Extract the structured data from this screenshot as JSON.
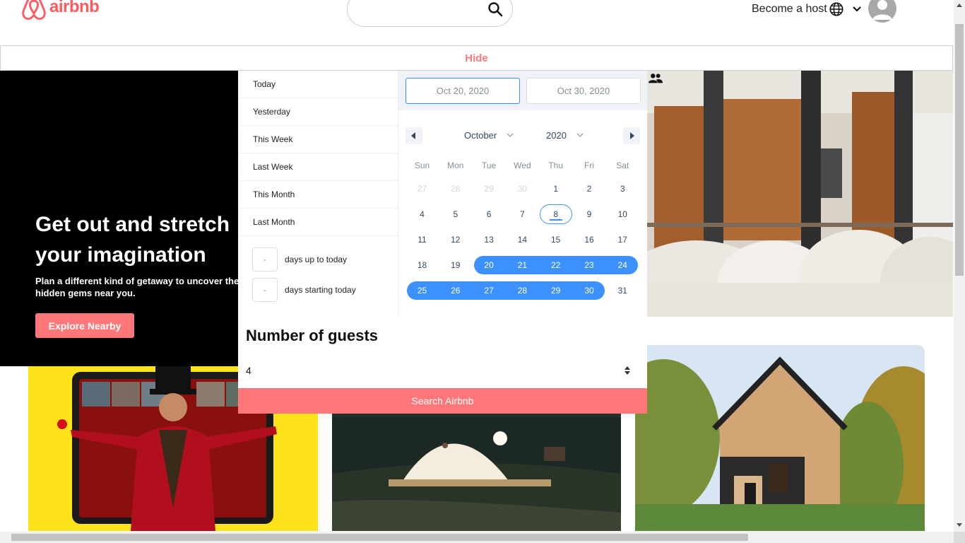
{
  "header": {
    "logo_text": "airbnb",
    "become_host": "Become a host"
  },
  "hide_label": "Hide",
  "hero": {
    "title_line1": "Get out and stretch",
    "title_line2": "your imagination",
    "subtitle_line1": "Plan a different kind of getaway to uncover the",
    "subtitle_line2": "hidden gems near you.",
    "explore_label": "Explore Nearby"
  },
  "date_picker": {
    "static_ranges": [
      "Today",
      "Yesterday",
      "This Week",
      "Last Week",
      "This Month",
      "Last Month"
    ],
    "input_ranges": [
      {
        "value": "-",
        "label": "days up to today"
      },
      {
        "value": "-",
        "label": "days starting today"
      }
    ],
    "start_date": "Oct 20, 2020",
    "end_date": "Oct 30, 2020",
    "month": "October",
    "year": "2020",
    "weekdays": [
      "Sun",
      "Mon",
      "Tue",
      "Wed",
      "Thu",
      "Fri",
      "Sat"
    ],
    "weeks": [
      [
        "27",
        "28",
        "29",
        "30",
        "1",
        "2",
        "3"
      ],
      [
        "4",
        "5",
        "6",
        "7",
        "8",
        "9",
        "10"
      ],
      [
        "11",
        "12",
        "13",
        "14",
        "15",
        "16",
        "17"
      ],
      [
        "18",
        "19",
        "20",
        "21",
        "22",
        "23",
        "24"
      ],
      [
        "25",
        "26",
        "27",
        "28",
        "29",
        "30",
        "31"
      ]
    ],
    "passive_days": [
      "27",
      "28",
      "29",
      "30"
    ],
    "today": "8",
    "selected_range": {
      "start": "20",
      "end": "30"
    },
    "accent_color": "#3d91ff"
  },
  "guests": {
    "title": "Number of guests",
    "value": "4"
  },
  "search_label": "Search Airbnb",
  "brand_color": "#FF5A5F",
  "button_color": "#FF7779"
}
